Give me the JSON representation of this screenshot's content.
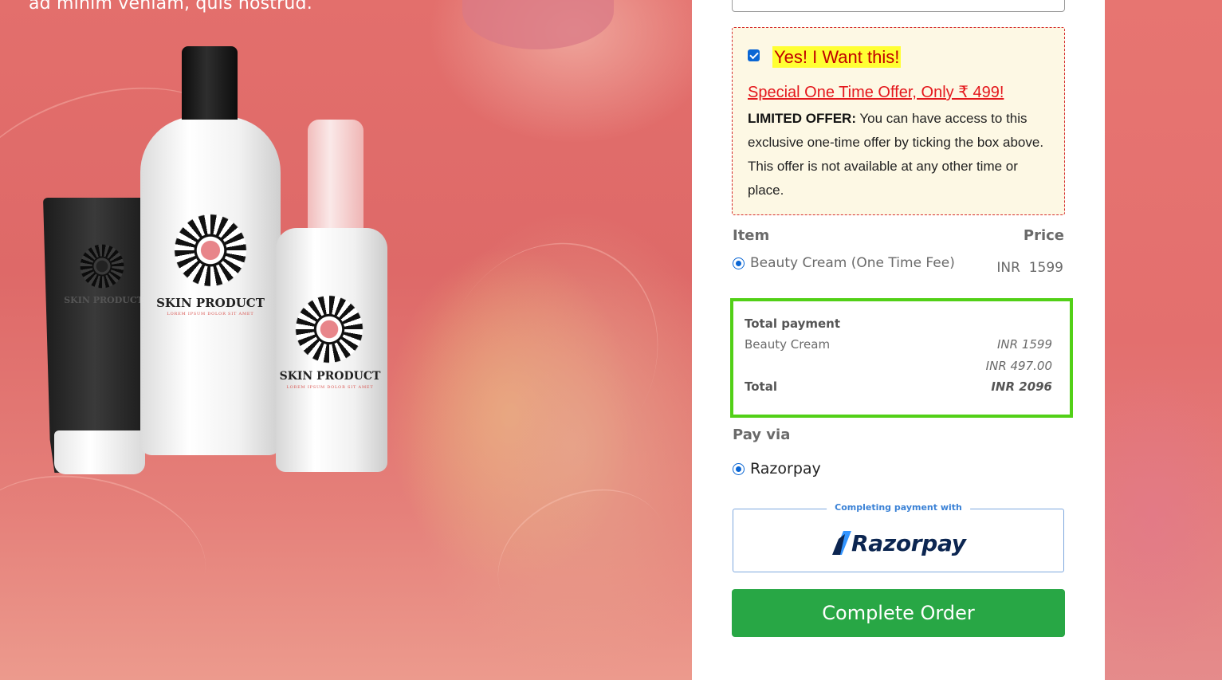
{
  "hero": {
    "text": "ad minim veniam, quis nostrud.",
    "products": [
      {
        "brand": "SKIN PRODUCT",
        "tagline": ""
      },
      {
        "brand": "SKIN PRODUCT",
        "tagline": "LOREM IPSUM DOLOR SIT AMET"
      },
      {
        "brand": "SKIN PRODUCT",
        "tagline": "LOREM IPSUM DOLOR SIT AMET"
      }
    ]
  },
  "offer": {
    "checked": true,
    "checkbox_icon": "checkbox-checked-icon",
    "headline": "Yes! I Want this!",
    "special": "Special One Time Offer, Only ₹ 499!",
    "limited_label": "LIMITED OFFER:",
    "description": " You can have access to this exclusive one-time offer by ticking the box above. This offer is not available at any other time or place."
  },
  "items": {
    "header_item": "Item",
    "header_price": "Price",
    "rows": [
      {
        "name": "Beauty Cream (One Time Fee)",
        "price": "INR  1599",
        "selected": true
      }
    ]
  },
  "totals": {
    "title": "Total payment",
    "lines": [
      {
        "label": "Beauty Cream",
        "value": "INR 1599"
      },
      {
        "label": "",
        "value": "INR 497.00"
      }
    ],
    "total_label": "Total",
    "total_value": "INR 2096"
  },
  "payment": {
    "heading": "Pay via",
    "method": "Razorpay",
    "selected": true,
    "badge_caption": "Completing payment with",
    "badge_logo": "Razorpay",
    "badge_icon": "razorpay-logo-icon"
  },
  "actions": {
    "complete_label": "Complete Order"
  },
  "colors": {
    "accent_green": "#28a745",
    "highlight_border": "#52d017",
    "offer_red": "#e4181d",
    "offer_yellow": "#ffff33",
    "razorpay_blue": "#3b82d6"
  }
}
